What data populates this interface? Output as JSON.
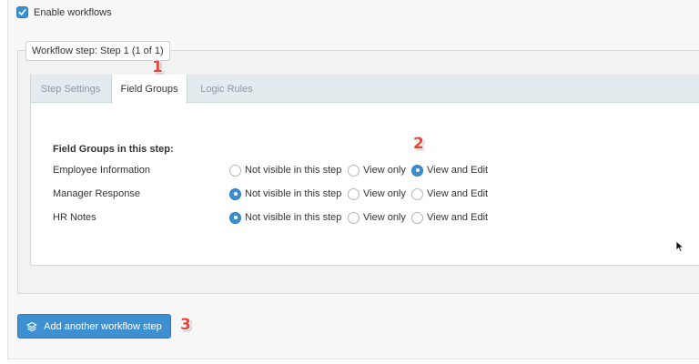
{
  "enable_workflows": {
    "label": "Enable workflows",
    "checked": true
  },
  "workflow_step": {
    "legend": "Workflow step: Step 1 (1 of 1)",
    "tabs": [
      {
        "label": "Step Settings",
        "active": false
      },
      {
        "label": "Field Groups",
        "active": true
      },
      {
        "label": "Logic Rules",
        "active": false
      }
    ],
    "section_title": "Field Groups in this step:",
    "option_labels": [
      "Not visible in this step",
      "View only",
      "View and Edit"
    ],
    "groups": [
      {
        "name": "Employee Information",
        "selected": "View and Edit"
      },
      {
        "name": "Manager Response",
        "selected": "Not visible in this step"
      },
      {
        "name": "HR Notes",
        "selected": "Not visible in this step"
      }
    ]
  },
  "add_button": {
    "label": "Add another workflow step",
    "icon": "layers-icon"
  },
  "annotations": [
    "1",
    "2",
    "3"
  ],
  "colors": {
    "accent": "#3d90d1",
    "marker": "#e5483a",
    "tab_bar": "#e4ebee"
  }
}
